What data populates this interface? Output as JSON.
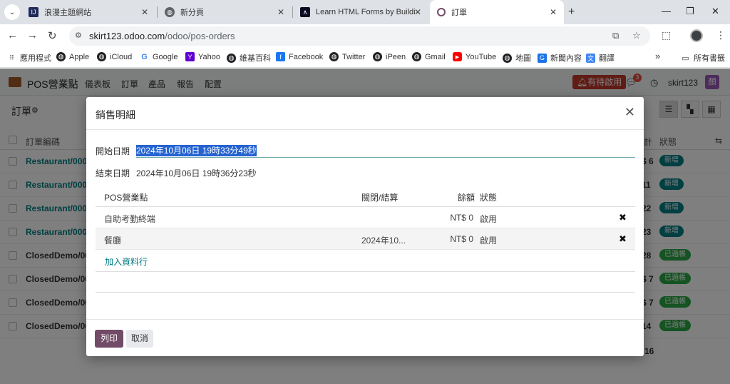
{
  "browser": {
    "tabs": [
      {
        "title": "浪漫主题網站",
        "favicon": "IJ"
      },
      {
        "title": "新分頁"
      },
      {
        "title": "Learn HTML Forms by Buildin"
      },
      {
        "title": "訂單"
      }
    ],
    "url_host": "skirt123.odoo.com",
    "url_path": "/odoo/pos-orders",
    "bookmarks": [
      "應用程式",
      "Apple",
      "iCloud",
      "Google",
      "Yahoo",
      "維基百科",
      "Facebook",
      "Twitter",
      "iPeen",
      "Gmail",
      "YouTube",
      "地圖",
      "新聞內容",
      "翻譯"
    ],
    "bookmarks_more": "»",
    "all_bookmarks": "所有書籤"
  },
  "odoo": {
    "app_name": "POS營業點",
    "menu": [
      "儀表板",
      "訂單",
      "產品",
      "報告",
      "配置"
    ],
    "pending_label": "有待啟用",
    "chat_count": "3",
    "username": "skirt123",
    "avatar_letter": "顏",
    "page_title": "訂單",
    "list": {
      "col_order_ref": "訂單編碼",
      "col_total_tail": "計",
      "col_status": "狀態",
      "rows": [
        {
          "ref": "Restaurant/0000",
          "total_tail": "$ 6",
          "status": "新增",
          "link": true
        },
        {
          "ref": "Restaurant/0000",
          "total_tail": "11",
          "status": "新增",
          "link": true
        },
        {
          "ref": "Restaurant/0000",
          "total_tail": "22",
          "status": "新增",
          "link": true
        },
        {
          "ref": "Restaurant/0000",
          "total_tail": "23",
          "status": "新增",
          "link": true
        },
        {
          "ref": "ClosedDemo/000",
          "total_tail": "28",
          "status": "已過帳",
          "link": false
        },
        {
          "ref": "ClosedDemo/000",
          "total_tail": "$ 7",
          "status": "已過帳",
          "link": false
        },
        {
          "ref": "ClosedDemo/000",
          "total_tail": "$ 7",
          "status": "已過帳",
          "link": false
        },
        {
          "ref": "ClosedDemo/000",
          "total_tail": "14",
          "status": "已過帳",
          "link": false
        }
      ],
      "sum_tail": "16"
    },
    "colors": {
      "new_badge": "#017e84",
      "posted_badge": "#28a745",
      "primary": "#714b67"
    }
  },
  "dialog": {
    "title": "銷售明細",
    "start_label": "開始日期",
    "start_value": "2024年10月06日 19時33分49秒",
    "end_label": "結束日期",
    "end_value": "2024年10月06日 19時36分23秒",
    "table": {
      "headers": {
        "pos": "POS營業點",
        "closing": "關閉/結算",
        "balance": "餘額",
        "status": "狀態"
      },
      "rows": [
        {
          "pos": "自助考勤終端",
          "closing": "",
          "balance": "NT$ 0",
          "status": "啟用"
        },
        {
          "pos": "餐廳",
          "closing": "2024年10...",
          "balance": "NT$ 0",
          "status": "啟用"
        }
      ],
      "add_line": "加入資料行"
    },
    "print_label": "列印",
    "cancel_label": "取消"
  }
}
